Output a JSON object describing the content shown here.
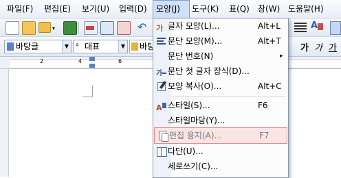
{
  "menubar": {
    "items": [
      {
        "label": "파일(F)"
      },
      {
        "label": "편집(E)"
      },
      {
        "label": "보기(U)"
      },
      {
        "label": "입력(D)"
      },
      {
        "label": "모양(J)"
      },
      {
        "label": "도구(K)"
      },
      {
        "label": "표(Q)"
      },
      {
        "label": "창(W)"
      },
      {
        "label": "도움말(H)"
      }
    ]
  },
  "toolbar2": {
    "style_combo": "바탕글",
    "shape_combo": "대표",
    "font_combo": "바탕",
    "bold_glyph": "가",
    "italic_glyph": "가",
    "underline_glyph": "가"
  },
  "ruler": {
    "tick_labels": [
      "2",
      "4",
      "6"
    ]
  },
  "menu": {
    "items": [
      {
        "label": "글자 모양(L)...",
        "shortcut": "Alt+L"
      },
      {
        "label": "문단 모양(M)...",
        "shortcut": "Alt+T"
      },
      {
        "label": "문단 번호(N)",
        "shortcut": ""
      },
      {
        "label": "문단 첫 글자 장식(D)...",
        "shortcut": ""
      },
      {
        "label": "모양 복사(O)...",
        "shortcut": "Alt+C"
      },
      {
        "label": "스타일(S)...",
        "shortcut": "F6"
      },
      {
        "label": "스타일마당(Y)...",
        "shortcut": ""
      },
      {
        "label": "편집 용지(A)...",
        "shortcut": "F7"
      },
      {
        "label": "다단(U)...",
        "shortcut": ""
      },
      {
        "label": "세로쓰기(C)...",
        "shortcut": ""
      }
    ],
    "submenu_arrow": "▸"
  }
}
